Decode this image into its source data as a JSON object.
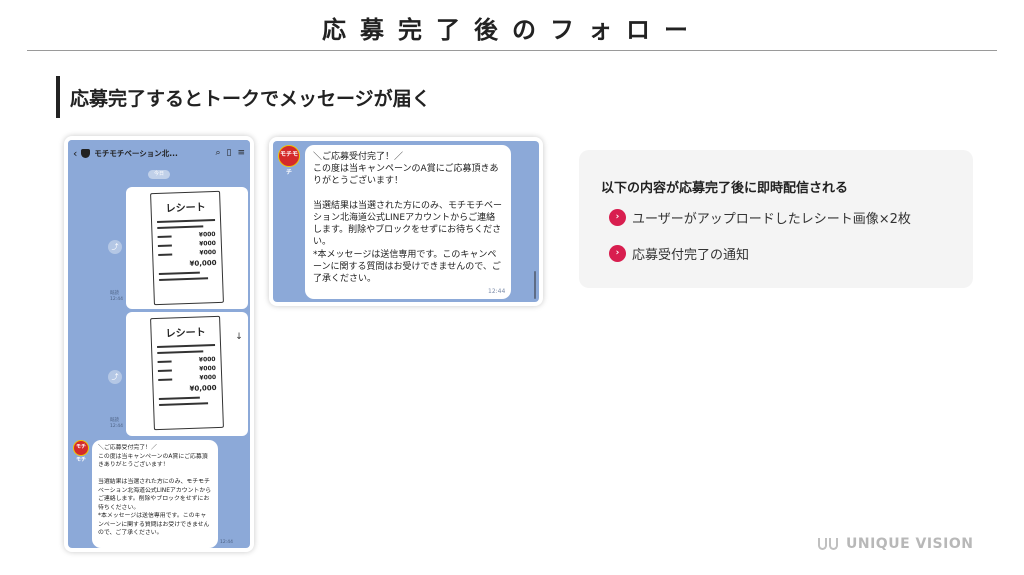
{
  "slide": {
    "title": "応募完了後のフォロー",
    "section_heading": "応募完了するとトークでメッセージが届く"
  },
  "phone_chat": {
    "header": {
      "back": "‹",
      "channel_name": "モチモチベーション北...",
      "icons": [
        "search-icon",
        "note-icon",
        "menu-icon"
      ]
    },
    "date_label": "今日",
    "receipts": [
      {
        "title": "レシート",
        "rows": [
          "¥000",
          "¥000",
          "¥000"
        ],
        "total": "¥0,000",
        "read": "既読",
        "time": "12:44"
      },
      {
        "title": "レシート",
        "rows": [
          "¥000",
          "¥000",
          "¥000"
        ],
        "total": "¥0,000",
        "read": "既読",
        "time": "12:44"
      }
    ],
    "avatar_label": "モチモチ",
    "message": "＼ご応募受付完了！／\nこの度は当キャンペーンのA賞にご応募頂きありがとうございます！\n\n当選結果は当選された方にのみ、モチモチベーション北海道公式LINEアカウントからご連絡します。削除やブロックをせずにお待ちください。\n*本メッセージは送信専用です。このキャンペーンに関する質問はお受けできませんので、ご了承ください。",
    "message_time": "12:44"
  },
  "phone_zoom": {
    "avatar_label": "モチモチ",
    "message": "＼ご応募受付完了！／\nこの度は当キャンペーンのA賞にご応募頂きありがとうございます！\n\n当選結果は当選された方にのみ、モチモチベーション北海道公式LINEアカウントからご連絡します。削除やブロックをせずにお待ちください。\n*本メッセージは送信専用です。このキャンペーンに関する質問はお受けできませんので、ご了承ください。",
    "message_time": "12:44"
  },
  "info_card": {
    "heading": "以下の内容が応募完了後に即時配信される",
    "items": [
      "ユーザーがアップロードしたレシート画像×2枚",
      "応募受付完了の通知"
    ]
  },
  "logo": {
    "text": "UNIQUE VISION"
  },
  "colors": {
    "chat_background": "#8ca9d8",
    "accent_pink": "#d81e4f",
    "card_background": "#f4f4f4"
  }
}
